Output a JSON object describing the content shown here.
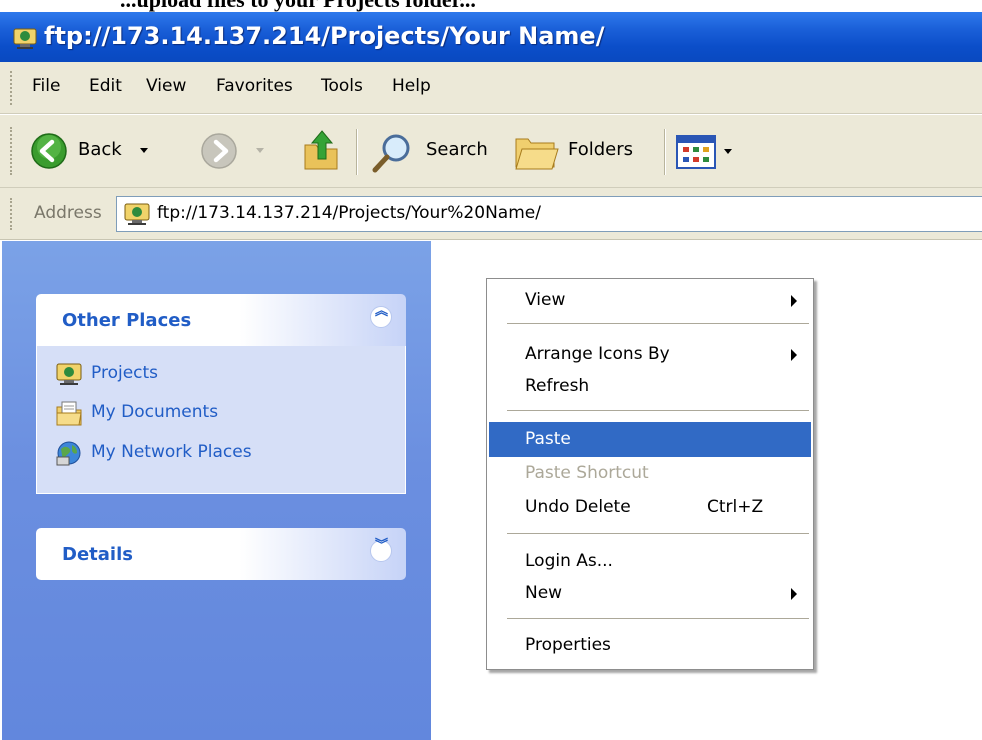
{
  "caption": {
    "text": "...upload files to your Projects folder..."
  },
  "window": {
    "title": "ftp://173.14.137.214/Projects/Your Name/"
  },
  "menubar": {
    "items": [
      "File",
      "Edit",
      "View",
      "Favorites",
      "Tools",
      "Help"
    ]
  },
  "toolbar": {
    "back_label": "Back",
    "search_label": "Search",
    "folders_label": "Folders",
    "icons": [
      "back-arrow-icon",
      "forward-arrow-icon",
      "up-folder-icon",
      "search-icon",
      "folders-icon",
      "views-icon"
    ]
  },
  "address": {
    "label": "Address",
    "value": "ftp://173.14.137.214/Projects/Your%20Name/"
  },
  "taskpane": {
    "other_places": {
      "title": "Other Places",
      "items": [
        {
          "label": "Projects",
          "icon": "ftp-folder-icon"
        },
        {
          "label": "My Documents",
          "icon": "my-documents-icon"
        },
        {
          "label": "My Network Places",
          "icon": "network-places-icon"
        }
      ]
    },
    "details": {
      "title": "Details"
    }
  },
  "context_menu": {
    "items": [
      {
        "label": "View",
        "submenu": true
      },
      {
        "label": "Arrange Icons By",
        "submenu": true
      },
      {
        "label": "Refresh"
      },
      {
        "label": "Paste",
        "highlighted": true
      },
      {
        "label": "Paste Shortcut",
        "disabled": true
      },
      {
        "label": "Undo Delete",
        "shortcut": "Ctrl+Z"
      },
      {
        "label": "Login As..."
      },
      {
        "label": "New",
        "submenu": true
      },
      {
        "label": "Properties"
      }
    ]
  },
  "colors": {
    "titlebar": "#0a49c0",
    "menu_highlight": "#316ac5",
    "taskpane_link": "#215dc6"
  }
}
